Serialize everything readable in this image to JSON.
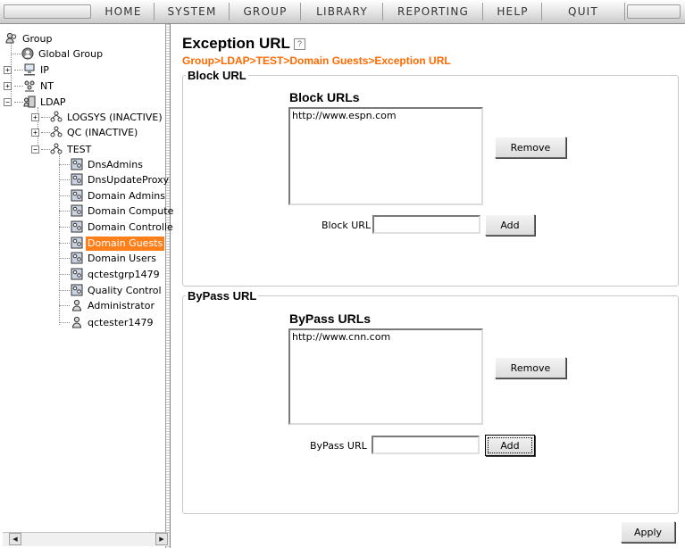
{
  "menu": {
    "items": [
      {
        "label": "HOME"
      },
      {
        "label": "SYSTEM"
      },
      {
        "label": "GROUP"
      },
      {
        "label": "LIBRARY"
      },
      {
        "label": "REPORTING"
      },
      {
        "label": "HELP"
      },
      {
        "label": "QUIT"
      }
    ]
  },
  "tree": {
    "root": "Group",
    "global_group": "Global Group",
    "ip": "IP",
    "nt": "NT",
    "ldap": "LDAP",
    "logsys": "LOGSYS (INACTIVE)",
    "qc": "QC (INACTIVE)",
    "test": "TEST",
    "groups": [
      {
        "label": "DnsAdmins"
      },
      {
        "label": "DnsUpdateProxy"
      },
      {
        "label": "Domain Admins"
      },
      {
        "label": "Domain Compute"
      },
      {
        "label": "Domain Controlle"
      },
      {
        "label": "Domain Guests",
        "selected": true
      },
      {
        "label": "Domain Users"
      },
      {
        "label": "qctestgrp1479"
      },
      {
        "label": "Quality Control"
      }
    ],
    "users": [
      {
        "label": "Administrator"
      },
      {
        "label": "qctester1479"
      }
    ]
  },
  "main": {
    "title": "Exception URL",
    "help_icon": "?",
    "breadcrumb": "Group>LDAP>TEST>Domain Guests>Exception URL",
    "block": {
      "legend": "Block URL",
      "list_title": "Block URLs",
      "items": [
        "http://www.espn.com"
      ],
      "remove_label": "Remove",
      "input_label": "Block URL",
      "input_value": "",
      "add_label": "Add"
    },
    "bypass": {
      "legend": "ByPass URL",
      "list_title": "ByPass URLs",
      "items": [
        "http://www.cnn.com"
      ],
      "remove_label": "Remove",
      "input_label": "ByPass URL",
      "input_value": "",
      "add_label": "Add"
    },
    "apply_label": "Apply"
  },
  "colors": {
    "accent": "#ff6a00",
    "selection": "#ff7f1a"
  }
}
